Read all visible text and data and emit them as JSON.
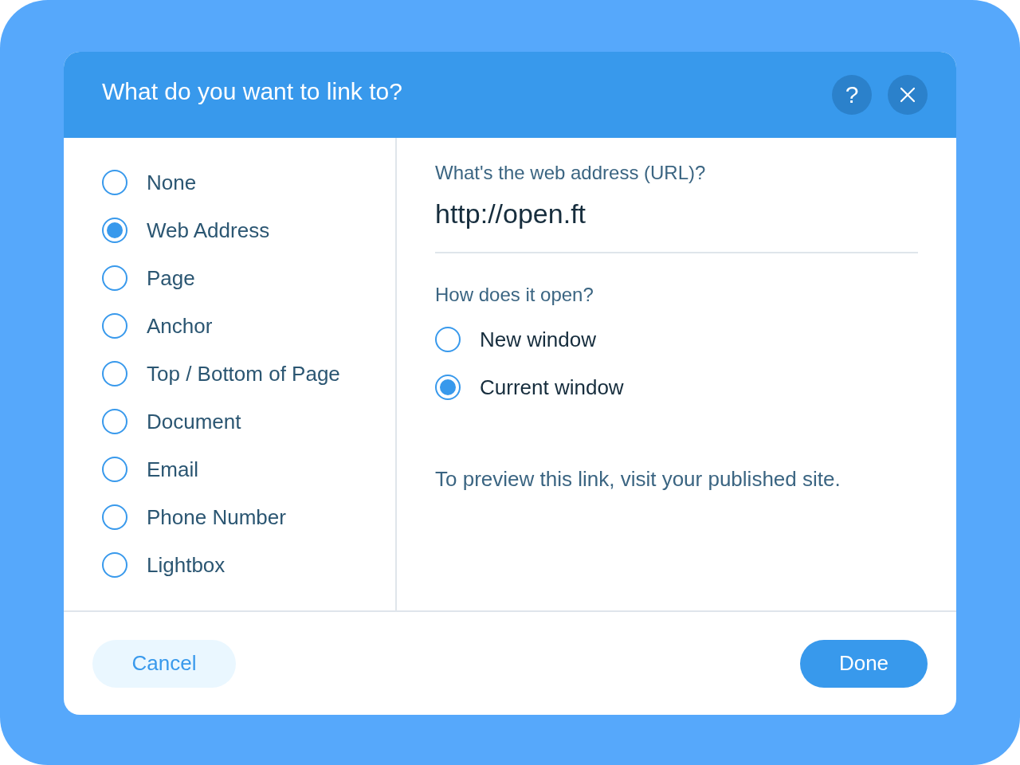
{
  "dialog": {
    "title": "What do you want to link to?"
  },
  "header_buttons": [
    {
      "kind": "help",
      "label": "?"
    },
    {
      "kind": "close"
    }
  ],
  "link_types": [
    {
      "label": "None",
      "selected": false
    },
    {
      "label": "Web Address",
      "selected": true
    },
    {
      "label": "Page",
      "selected": false
    },
    {
      "label": "Anchor",
      "selected": false
    },
    {
      "label": "Top / Bottom of Page",
      "selected": false
    },
    {
      "label": "Document",
      "selected": false
    },
    {
      "label": "Email",
      "selected": false
    },
    {
      "label": "Phone Number",
      "selected": false
    },
    {
      "label": "Lightbox",
      "selected": false
    }
  ],
  "url_field": {
    "label": "What's the web address (URL)?",
    "value": "http://open.ft"
  },
  "open_mode": {
    "label": "How does it open?",
    "options": [
      {
        "label": "New window",
        "selected": false
      },
      {
        "label": "Current window",
        "selected": true
      }
    ]
  },
  "note": "To preview this link, visit your published site.",
  "buttons": [
    {
      "label": "Cancel",
      "kind": "secondary"
    },
    {
      "label": "Done",
      "kind": "primary"
    }
  ]
}
